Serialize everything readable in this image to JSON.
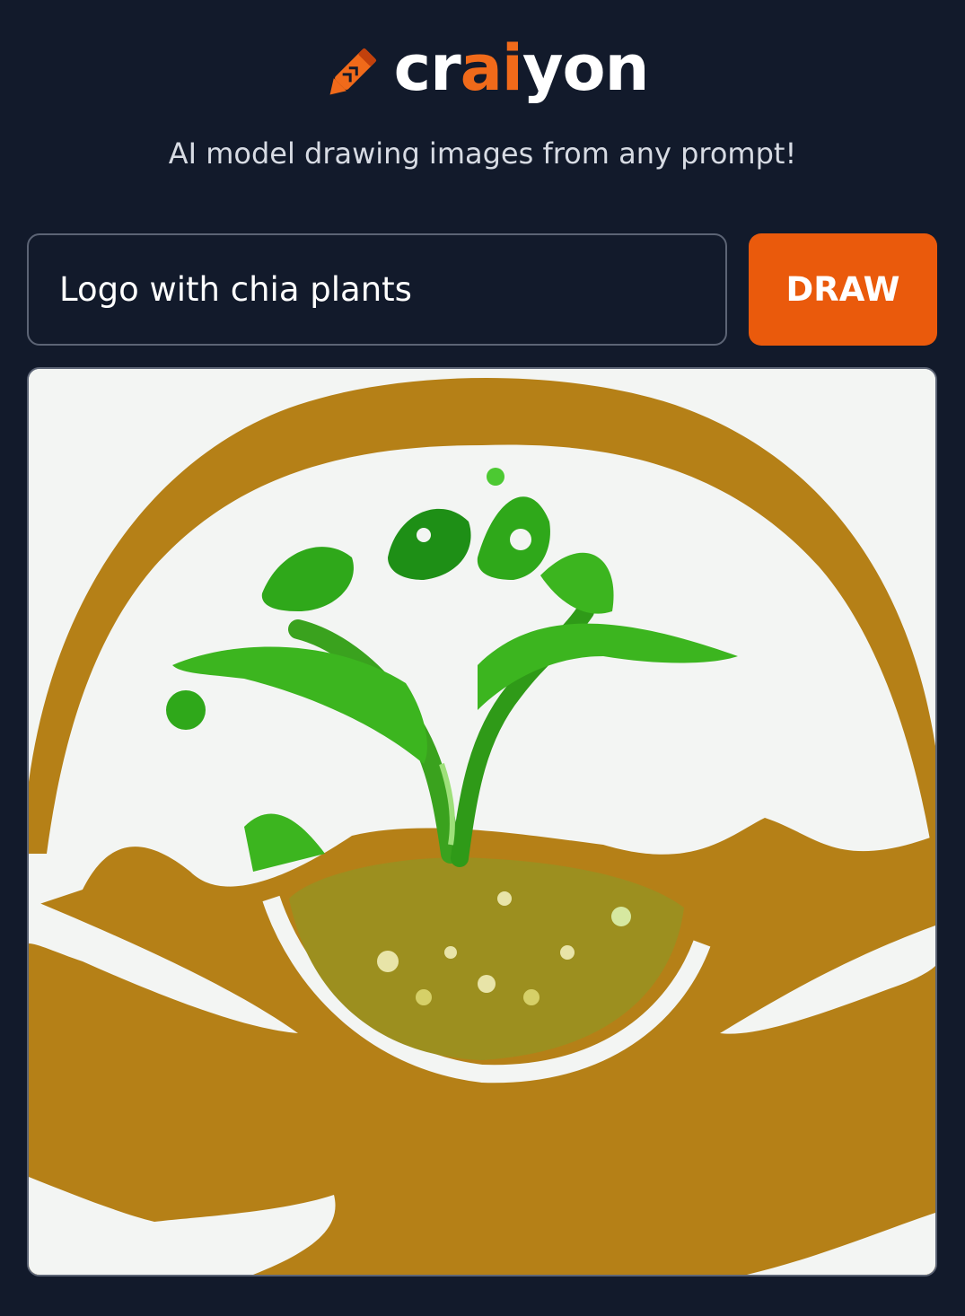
{
  "brand": {
    "prefix": "cr",
    "accent": "ai",
    "suffix": "yon",
    "accent_color": "#f06a1a"
  },
  "tagline": "AI model drawing images from any prompt!",
  "prompt": {
    "value": "Logo with chia plants"
  },
  "draw_button": {
    "label": "DRAW",
    "color": "#ea5a0c"
  },
  "colors": {
    "background": "#121a2b",
    "border": "#5c6475"
  },
  "icons": {
    "logo": "crayon-icon"
  }
}
